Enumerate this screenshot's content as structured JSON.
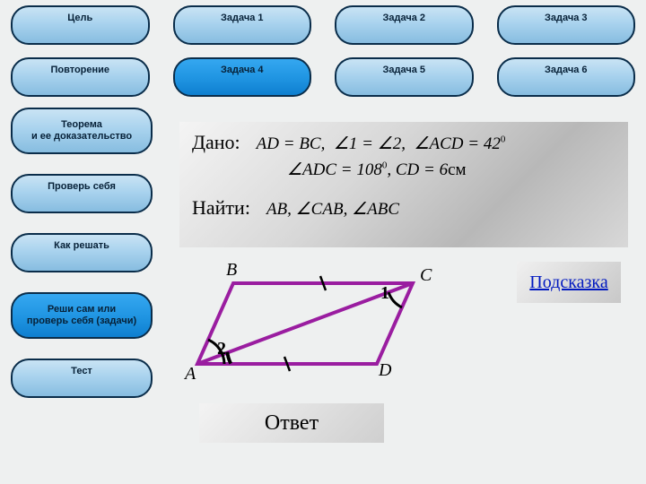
{
  "top": {
    "r1c1": "Цель",
    "r1c2": "Задача 1",
    "r1c3": "Задача 2",
    "r1c4": "Задача 3",
    "r2c1": "Повторение",
    "r2c2": "Задача 4",
    "r2c3": "Задача 5",
    "r2c4": "Задача 6"
  },
  "side": {
    "s1": "Теорема\nи ее доказательство",
    "s2": "Проверь себя",
    "s3": "Как решать",
    "s4": "Реши сам или\nпроверь себя (задачи)",
    "s5": "Тест"
  },
  "given": {
    "label_given": "Дано:",
    "line1_a": "AD = BC,",
    "line1_b": "∠1 = ∠2,",
    "line1_c_pre": "∠ACD = 42",
    "line2_pre": "∠ADC = 108",
    "line2_mid": ", CD = 6",
    "line2_unit": "см",
    "label_find": "Найти:",
    "find_expr": "AB, ∠CAB, ∠ABC"
  },
  "figure": {
    "A": "A",
    "B": "B",
    "C": "C",
    "D": "D",
    "ang1": "1",
    "ang2": "2"
  },
  "hint": "Подсказка",
  "answer": "Ответ"
}
